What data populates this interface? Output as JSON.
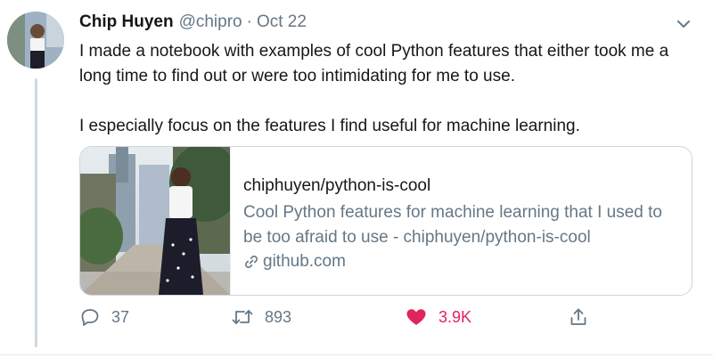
{
  "tweet": {
    "author_name": "Chip Huyen",
    "handle": "@chipro",
    "separator": "·",
    "timestamp": "Oct 22",
    "paragraphs": [
      "I made a notebook with examples of cool Python features that either took me a long time to find out or were too intimidating for me to use.",
      "I especially focus on the features I find useful for machine learning."
    ]
  },
  "card": {
    "title": "chiphuyen/python-is-cool",
    "description": "Cool Python features for machine learning that I used to be too afraid to use - chiphuyen/python-is-cool",
    "domain": "github.com"
  },
  "actions": {
    "reply_count": "37",
    "retweet_count": "893",
    "like_count": "3.9K",
    "liked": true
  },
  "colors": {
    "text": "#14171a",
    "secondary": "#657786",
    "like": "#e0245e",
    "border": "#ccd6dd"
  },
  "icons": [
    "chevron-down-icon",
    "link-icon",
    "reply-icon",
    "retweet-icon",
    "heart-icon",
    "share-icon"
  ]
}
